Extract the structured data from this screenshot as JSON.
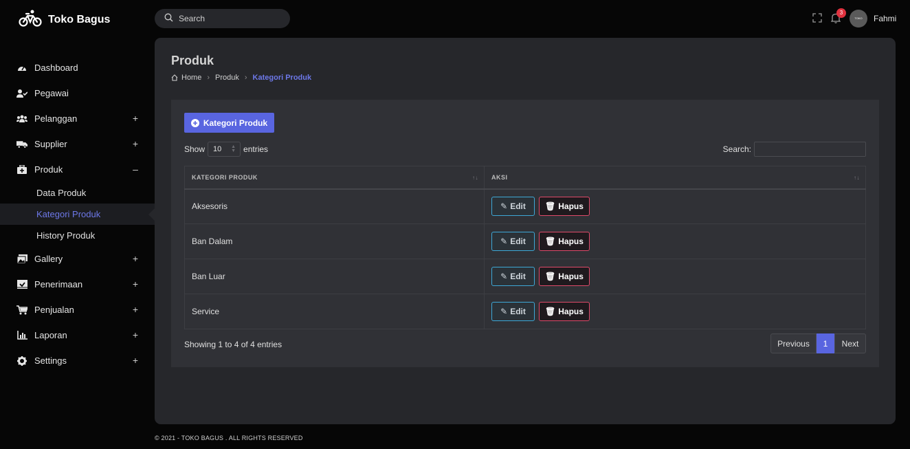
{
  "brand": {
    "name": "Toko Bagus"
  },
  "sidebar": {
    "items": [
      {
        "label": "Dashboard",
        "icon": "dashboard-icon",
        "toggle": ""
      },
      {
        "label": "Pegawai",
        "icon": "user-check-icon",
        "toggle": ""
      },
      {
        "label": "Pelanggan",
        "icon": "users-icon",
        "toggle": "+"
      },
      {
        "label": "Supplier",
        "icon": "truck-icon",
        "toggle": "+"
      },
      {
        "label": "Produk",
        "icon": "medkit-icon",
        "toggle": "–"
      }
    ],
    "produk_sub": [
      {
        "label": "Data Produk"
      },
      {
        "label": "Kategori Produk",
        "active": true
      },
      {
        "label": "History Produk"
      }
    ],
    "items2": [
      {
        "label": "Gallery",
        "icon": "image-icon",
        "toggle": "+"
      },
      {
        "label": "Penerimaan",
        "icon": "inbox-check-icon",
        "toggle": "+"
      },
      {
        "label": "Penjualan",
        "icon": "cart-icon",
        "toggle": "+"
      },
      {
        "label": "Laporan",
        "icon": "chart-icon",
        "toggle": "+"
      },
      {
        "label": "Settings",
        "icon": "gear-icon",
        "toggle": "+"
      }
    ]
  },
  "topbar": {
    "search_placeholder": "Search",
    "notification_count": "3",
    "avatar_text": "TOKO BAGUS",
    "username": "Fahmi"
  },
  "page": {
    "title": "Produk",
    "breadcrumb": [
      "Home",
      "Produk",
      "Kategori Produk"
    ]
  },
  "card": {
    "add_button": "Kategori Produk",
    "show_label": "Show",
    "show_value": "10",
    "entries_label": "entries",
    "search_label": "Search:",
    "columns": [
      "KATEGORI PRODUK",
      "AKSI"
    ],
    "rows": [
      {
        "name": "Aksesoris"
      },
      {
        "name": "Ban Dalam"
      },
      {
        "name": "Ban Luar"
      },
      {
        "name": "Service"
      }
    ],
    "edit_label": "Edit",
    "delete_label": "Hapus",
    "info": "Showing 1 to 4 of 4 entries",
    "pager": {
      "prev": "Previous",
      "page": "1",
      "next": "Next"
    }
  },
  "footer": "© 2021 - TOKO BAGUS . ALL RIGHTS RESERVED",
  "colors": {
    "accent": "#5965e0",
    "edit_border": "#3ea9d8",
    "delete_border": "#e04a6a",
    "badge": "#e0323f"
  }
}
